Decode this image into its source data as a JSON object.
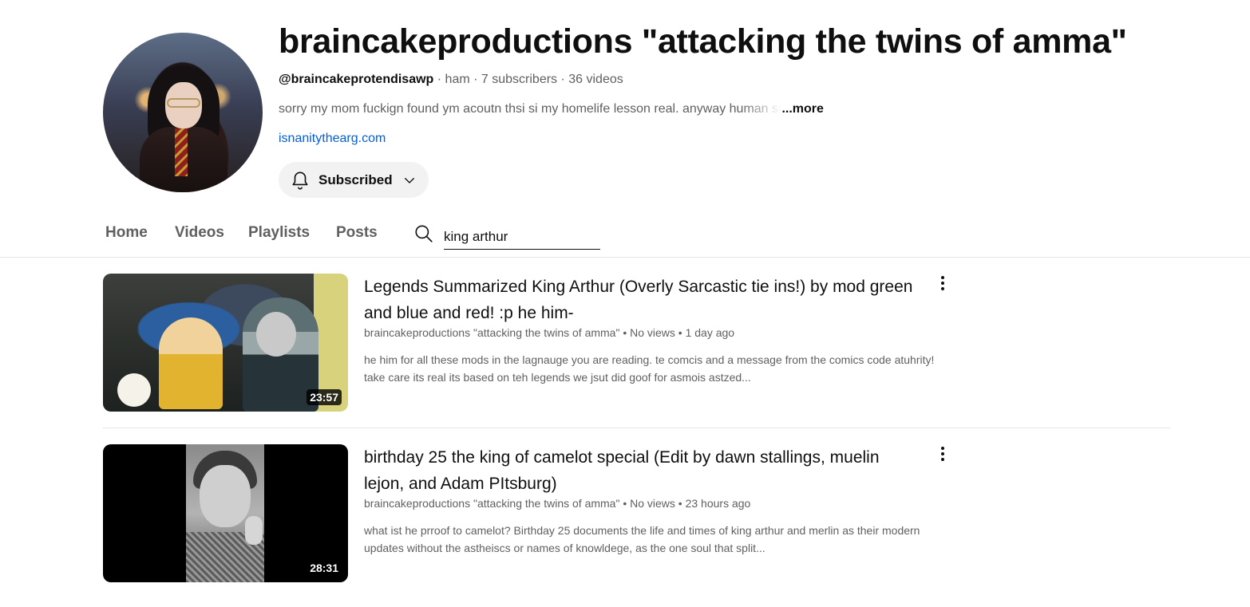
{
  "channel": {
    "title": "braincakeproductions \"attacking the twins of amma\"",
    "handle": "@braincakeprotendisawp",
    "meta_rest": " · ham · 7 subscribers · 36 videos",
    "description": "sorry my mom fuckign found ym acoutn thsi si my homelife lesson real. anyway human st",
    "more_label": "...more",
    "link": "isnanitythearg.com",
    "subscribe_label": "Subscribed"
  },
  "tabs": [
    {
      "label": "Home"
    },
    {
      "label": "Videos"
    },
    {
      "label": "Playlists"
    },
    {
      "label": "Posts"
    }
  ],
  "search": {
    "value": "king arthur"
  },
  "videos": [
    {
      "title": "Legends Summarized King Arthur (Overly Sarcastic tie ins!) by mod green and blue and red! :p he him-",
      "meta": "braincakeproductions \"attacking the twins of amma\" • No views • 1 day ago",
      "description": "he him for all these mods in the lagnauge you are reading. te comcis and a message from the comics code atuhrity! take care its real its based on teh legends we jsut did goof for asmois astzed...",
      "duration": "23:57"
    },
    {
      "title": "birthday 25 the king of camelot special (Edit by dawn stallings, muelin lejon, and Adam PItsburg)",
      "meta": "braincakeproductions \"attacking the twins of amma\" • No views • 23 hours ago",
      "description": "what ist he prroof to camelot? Birthday 25 documents the life and times of king arthur and merlin as their modern updates without the astheiscs or names of knowldege, as the one soul that split...",
      "duration": "28:31"
    }
  ],
  "icons": {
    "bell": "bell-icon",
    "chevron": "chevron-down-icon",
    "search": "search-icon",
    "kebab": "more-vert-icon"
  },
  "colors": {
    "link": "#065fd4",
    "secondary_text": "#606060",
    "button_bg": "#f2f2f2"
  }
}
